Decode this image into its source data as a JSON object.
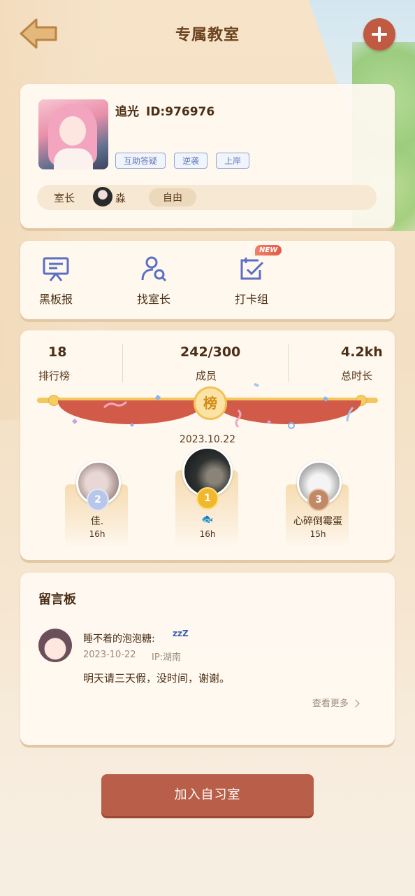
{
  "header": {
    "title": "专属教室",
    "back_icon": "back-arrow-icon",
    "add_icon": "plus-icon"
  },
  "profile": {
    "name": "追光",
    "id_text": "ID:976976",
    "tags": [
      "互助答疑",
      "逆袭",
      "上岸"
    ],
    "owner_label": "室长",
    "owner_name": "淼",
    "owner_status": "自由"
  },
  "functions": [
    {
      "label": "黑板报",
      "icon": "blackboard-icon"
    },
    {
      "label": "找室长",
      "icon": "find-person-icon"
    },
    {
      "label": "打卡组",
      "icon": "checkin-icon",
      "badge": "NEW"
    }
  ],
  "stats": {
    "rank_value": "18",
    "rank_label": "排行榜",
    "members_value": "242/300",
    "members_label": "成员",
    "time_value": "4.2kh",
    "time_label": "总时长"
  },
  "leaderboard": {
    "banner_char": "榜",
    "date": "2023.10.22",
    "first": {
      "rank": "1",
      "name": "🐟",
      "hours": "16h"
    },
    "second": {
      "rank": "2",
      "name": "佳.",
      "hours": "16h"
    },
    "third": {
      "rank": "3",
      "name": "心碎倒霉蛋",
      "hours": "15h"
    }
  },
  "message_board": {
    "title": "留言板",
    "messages": [
      {
        "author": "睡不着的泡泡糖:",
        "emoji": "zzZ",
        "date": "2023-10-22",
        "ip": "IP:湖南",
        "text": "明天请三天假，没时间，谢谢。"
      }
    ],
    "more_label": "查看更多"
  },
  "join_button": "加入自习室",
  "colors": {
    "accent": "#c05a42",
    "tag": "#5f78b8",
    "icon": "#5b6fc2",
    "gold": "#f2c257"
  }
}
